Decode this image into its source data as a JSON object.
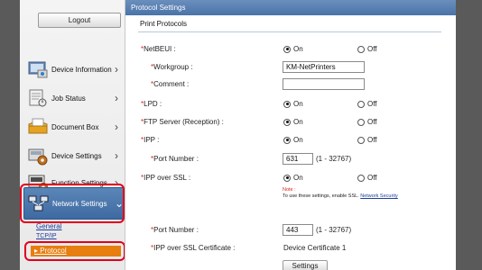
{
  "sidebar": {
    "logout_label": "Logout",
    "items": [
      {
        "label": "Device Information",
        "icon": "device-info-icon"
      },
      {
        "label": "Job Status",
        "icon": "job-status-icon"
      },
      {
        "label": "Document Box",
        "icon": "document-box-icon"
      },
      {
        "label": "Device Settings",
        "icon": "device-settings-icon"
      },
      {
        "label": "Function Settings",
        "icon": "function-settings-icon"
      },
      {
        "label": "Network Settings",
        "icon": "network-settings-icon",
        "active": true
      }
    ],
    "submenu": {
      "general": "General",
      "tcpip": "TCP/IP",
      "protocol": "Protocol"
    }
  },
  "main": {
    "header": "Protocol Settings",
    "section": "Print Protocols",
    "rows": {
      "netbeui": {
        "label": "NetBEUI :",
        "on": "On",
        "off": "Off",
        "selected": "On"
      },
      "workgroup": {
        "label": "Workgroup :",
        "value": "KM-NetPrinters"
      },
      "comment": {
        "label": "Comment :",
        "value": ""
      },
      "lpd": {
        "label": "LPD :",
        "on": "On",
        "off": "Off",
        "selected": "On"
      },
      "ftp": {
        "label": "FTP Server (Reception) :",
        "on": "On",
        "off": "Off",
        "selected": "On"
      },
      "ipp": {
        "label": "IPP :",
        "on": "On",
        "off": "Off",
        "selected": "On"
      },
      "ipp_port": {
        "label": "Port Number :",
        "value": "631",
        "range": "(1 - 32767)"
      },
      "ipp_ssl": {
        "label": "IPP over SSL :",
        "on": "On",
        "off": "Off",
        "selected": "On"
      },
      "ssl_note": {
        "head": "Note :",
        "text": "To use these settings, enable SSL.",
        "link": "Network Security"
      },
      "ssl_port": {
        "label": "Port Number :",
        "value": "443",
        "range": "(1 - 32767)"
      },
      "ssl_cert": {
        "label": "IPP over SSL Certificate :",
        "value": "Device Certificate 1"
      },
      "settings_button": "Settings"
    },
    "required_mark": "*"
  },
  "colors": {
    "header_blue": "#4a73a8",
    "highlight_ring": "#e2001a",
    "active_submenu": "#e67e10",
    "link": "#1f3f9a"
  }
}
